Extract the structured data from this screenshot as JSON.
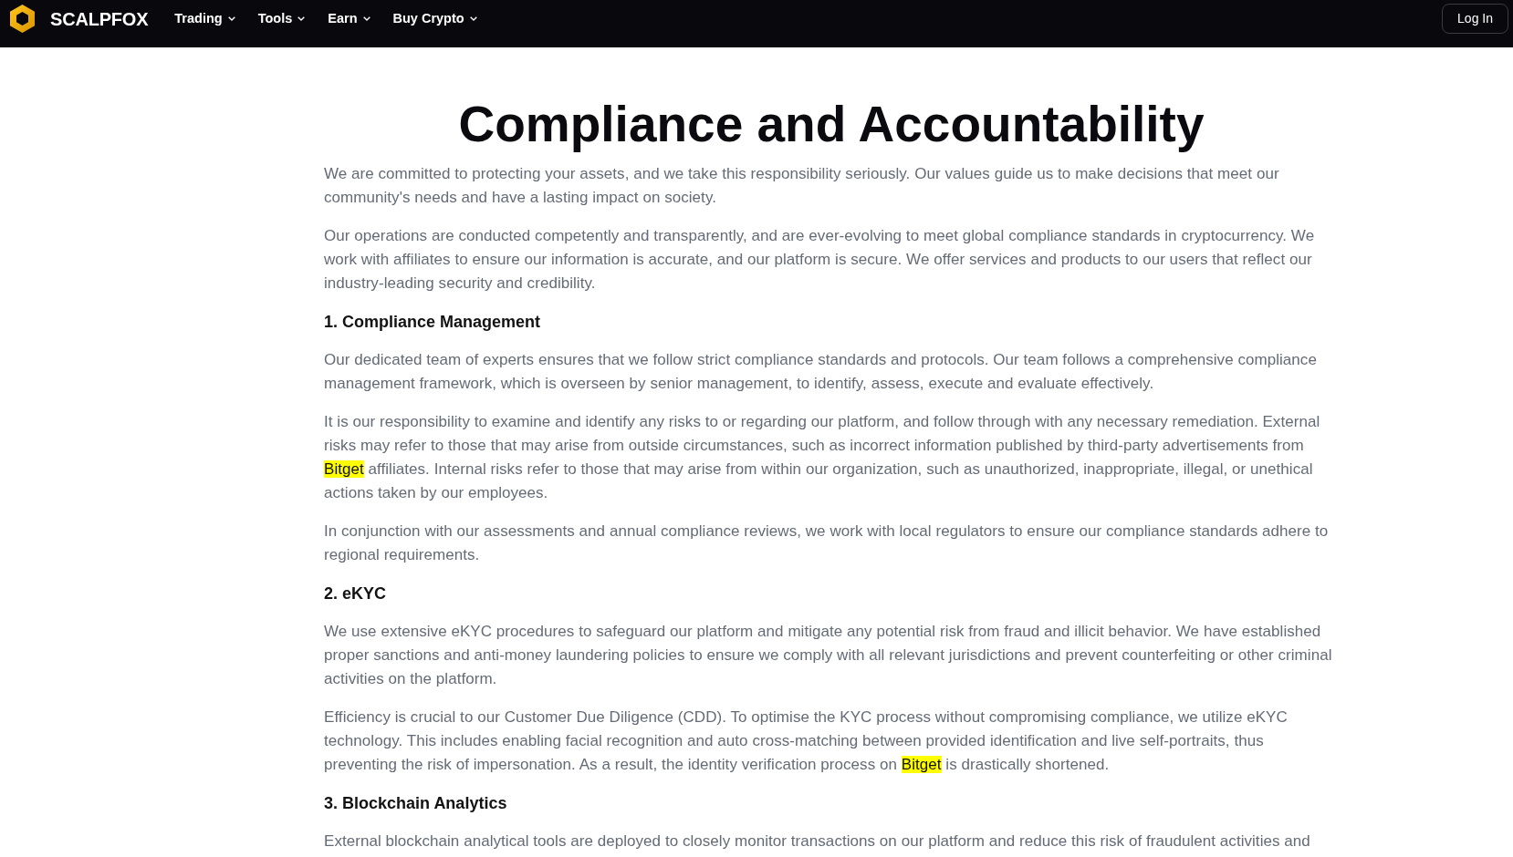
{
  "nav": {
    "brand": "SCALPFOX",
    "menu": [
      {
        "label": "Trading"
      },
      {
        "label": "Tools"
      },
      {
        "label": "Earn"
      },
      {
        "label": "Buy Crypto"
      }
    ],
    "login": "Log In"
  },
  "article": {
    "title": "Compliance and Accountability",
    "blocks": [
      {
        "kind": "paragraph",
        "segments": [
          {
            "text": "We are committed to protecting your assets, and we take this responsibility seriously. Our values guide us to make decisions that meet our community's needs and have a lasting impact on society.",
            "highlighted": false
          }
        ]
      },
      {
        "kind": "paragraph",
        "segments": [
          {
            "text": "Our operations are conducted competently and transparently, and are ever-evolving to meet global compliance standards in cryptocurrency. We work with affiliates to ensure our information is accurate, and our platform is secure. We offer services and products to our users that reflect our industry-leading security and credibility.",
            "highlighted": false
          }
        ]
      },
      {
        "kind": "heading",
        "text": "1. Compliance Management"
      },
      {
        "kind": "paragraph",
        "segments": [
          {
            "text": "Our dedicated team of experts ensures that we follow strict compliance standards and protocols. Our team follows a comprehensive compliance management framework, which is overseen by senior management, to identify, assess, execute and evaluate effectively.",
            "highlighted": false
          }
        ]
      },
      {
        "kind": "paragraph",
        "segments": [
          {
            "text": "It is our responsibility to examine and identify any risks to or regarding our platform, and follow through with any necessary remediation. External risks may refer to those that may arise from outside circumstances, such as incorrect information published by third-party advertisements from ",
            "highlighted": false
          },
          {
            "text": "Bitget",
            "highlighted": true
          },
          {
            "text": " affiliates. Internal risks refer to those that may arise from within our organization, such as unauthorized, inappropriate, illegal, or unethical actions taken by our employees.",
            "highlighted": false
          }
        ]
      },
      {
        "kind": "paragraph",
        "segments": [
          {
            "text": "In conjunction with our assessments and annual compliance reviews, we work with local regulators to ensure our compliance standards adhere to regional requirements.",
            "highlighted": false
          }
        ]
      },
      {
        "kind": "heading",
        "text": "2. eKYC"
      },
      {
        "kind": "paragraph",
        "segments": [
          {
            "text": "We use extensive eKYC procedures to safeguard our platform and mitigate any potential risk from fraud and illicit behavior. We have established proper sanctions and anti-money laundering policies to ensure we comply with all relevant jurisdictions and prevent counterfeiting or other criminal activities on the platform.",
            "highlighted": false
          }
        ]
      },
      {
        "kind": "paragraph",
        "segments": [
          {
            "text": "Efficiency is crucial to our Customer Due Diligence (CDD). To optimise the KYC process without compromising compliance, we utilize eKYC technology. This includes enabling facial recognition and auto cross-matching between provided identification and live self-portraits, thus preventing the risk of impersonation. As a result, the identity verification process on ",
            "highlighted": false
          },
          {
            "text": "Bitget",
            "highlighted": true
          },
          {
            "text": " is drastically shortened.",
            "highlighted": false
          }
        ]
      },
      {
        "kind": "heading",
        "text": "3. Blockchain Analytics"
      },
      {
        "kind": "paragraph",
        "segments": [
          {
            "text": "External blockchain analytical tools are deployed to closely monitor transactions on our platform and reduce this risk of fraudulent activities and",
            "highlighted": false
          }
        ]
      }
    ]
  }
}
